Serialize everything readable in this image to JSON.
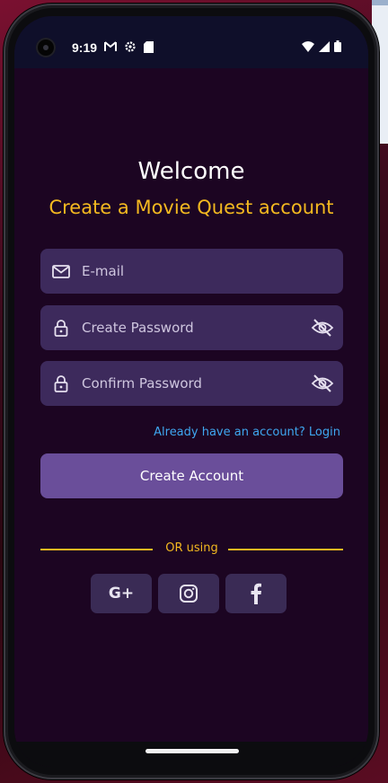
{
  "status_bar": {
    "time": "9:19"
  },
  "header": {
    "welcome": "Welcome",
    "subtitle": "Create a Movie Quest account"
  },
  "form": {
    "email_placeholder": "E-mail",
    "password_placeholder": "Create Password",
    "confirm_placeholder": "Confirm Password",
    "login_link": "Already have an account? Login",
    "submit_label": "Create Account"
  },
  "divider": {
    "label": "OR using"
  },
  "social": {
    "google_label": "G+",
    "instagram_icon": "instagram-icon",
    "facebook_icon": "facebook-icon"
  },
  "colors": {
    "background": "#1c0522",
    "field": "#3d2a5c",
    "accent": "#f4b920",
    "button": "#6a4e9a",
    "link": "#3fa7f0"
  }
}
